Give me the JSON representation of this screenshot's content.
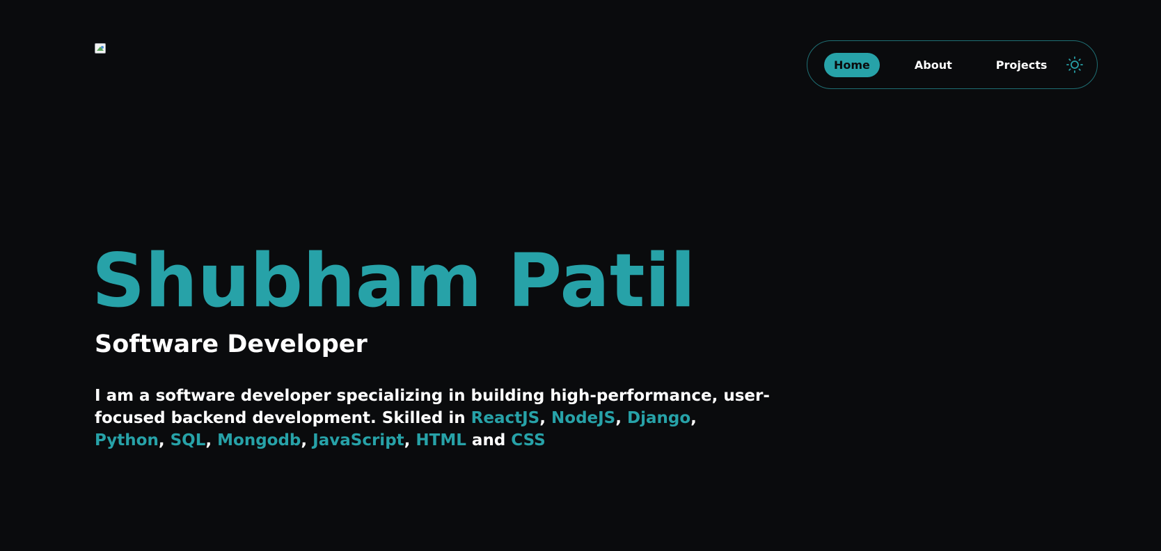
{
  "header": {
    "logo_alt": "logo"
  },
  "nav": {
    "items": [
      {
        "label": "Home",
        "active": true
      },
      {
        "label": "About",
        "active": false
      },
      {
        "label": "Projects",
        "active": false
      }
    ],
    "theme_icon": "sun-icon"
  },
  "hero": {
    "name": "Shubham Patil",
    "role": "Software Developer",
    "bio": {
      "line1": "I am a software developer specializing in building high-performance, user-",
      "line2_text": "focused backend development. Skilled in ",
      "skills": [
        "ReactJS",
        "NodeJS",
        "Django",
        "Python",
        "SQL",
        "Mongodb",
        "JavaScript",
        "HTML",
        "CSS"
      ],
      "separator": ",",
      "conjunction": "and"
    }
  },
  "colors": {
    "background": "#0a0b0d",
    "accent": "#27a2a8",
    "text": "#ffffff",
    "nav_border": "#1f6f74"
  }
}
